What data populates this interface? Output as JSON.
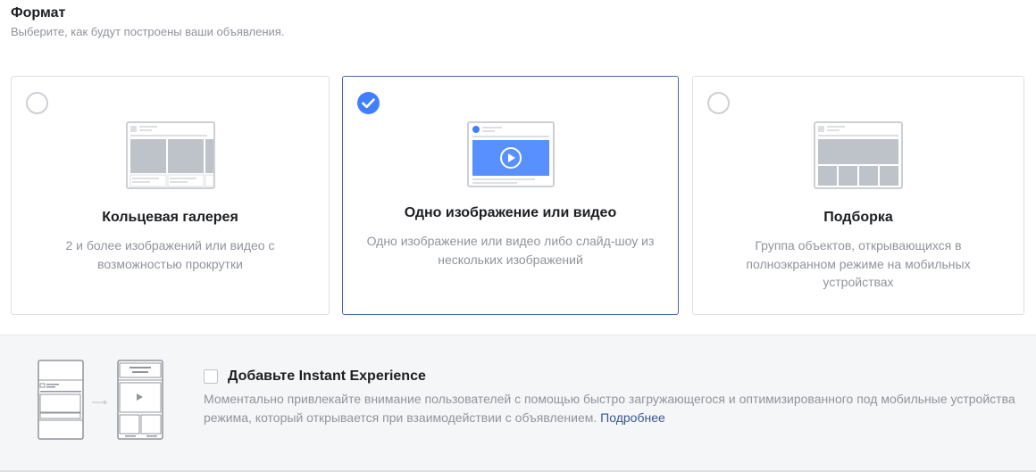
{
  "format": {
    "title": "Формат",
    "subtitle": "Выберите, как будут построены ваши объявления."
  },
  "cards": [
    {
      "title": "Кольцевая галерея",
      "description": "2 и более изображений или видео с возможностью прокрутки",
      "selected": false,
      "icon": "carousel-illustration"
    },
    {
      "title": "Одно изображение или видео",
      "description": "Одно изображение или видео либо слайд-шоу из нескольких изображений",
      "selected": true,
      "icon": "single-video-illustration"
    },
    {
      "title": "Подборка",
      "description": "Группа объектов, открывающихся в полноэкранном режиме на мобильных устройствах",
      "selected": false,
      "icon": "collection-illustration"
    }
  ],
  "instant_experience": {
    "title": "Добавьте Instant Experience",
    "description": "Моментально привлекайте внимание пользователей с помощью быстро загружающегося и оптимизированного под мобильные устройства режима, который открывается при взаимодействии с объявлением.",
    "link": "Подробнее",
    "checked": false,
    "icon": "instant-experience-illustration"
  },
  "colors": {
    "accent": "#4080ff",
    "selected_border": "#4267b2",
    "muted_text": "#90949c",
    "link": "#365899"
  }
}
